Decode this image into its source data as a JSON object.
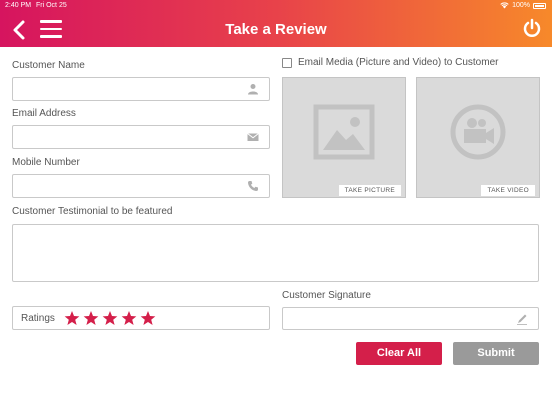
{
  "status_bar": {
    "time": "2:40 PM",
    "date": "Fri Oct 25",
    "battery": "100%"
  },
  "header": {
    "title": "Take a Review"
  },
  "form": {
    "customer_name_label": "Customer Name",
    "customer_name_value": "",
    "email_label": "Email Address",
    "email_value": "",
    "mobile_label": "Mobile Number",
    "mobile_value": "",
    "testimonial_label": "Customer Testimonial to be featured",
    "testimonial_value": "",
    "ratings_label": "Ratings",
    "ratings_value": 5,
    "signature_label": "Customer Signature"
  },
  "media": {
    "email_media_label": "Email Media (Picture and Video) to Customer",
    "email_media_checked": false,
    "take_picture_label": "TAKE PICTURE",
    "take_video_label": "TAKE VIDEO"
  },
  "buttons": {
    "clear_all": "Clear All",
    "submit": "Submit"
  },
  "colors": {
    "header_start": "#d6145f",
    "header_end": "#f7892a",
    "accent": "#d41f4a",
    "submit": "#9a9a9a",
    "star": "#d41f4a"
  },
  "icons": [
    "back-icon",
    "menu-icon",
    "power-icon",
    "person-icon",
    "envelope-icon",
    "phone-icon",
    "image-icon",
    "video-camera-icon",
    "star-icon",
    "pen-icon",
    "wifi-icon",
    "battery-icon"
  ]
}
